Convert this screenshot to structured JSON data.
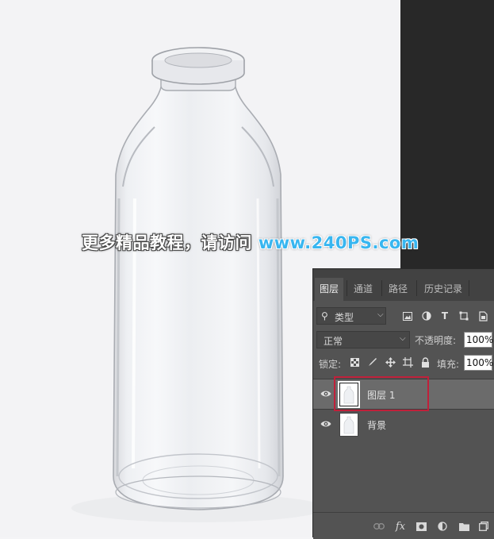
{
  "watermark": {
    "cn_text": "更多精品教程，请访问",
    "url_text": "www.240PS.com"
  },
  "layers_panel": {
    "tabs": [
      {
        "label": "图层",
        "active": true
      },
      {
        "label": "通道",
        "active": false
      },
      {
        "label": "路径",
        "active": false
      },
      {
        "label": "历史记录",
        "active": false
      }
    ],
    "filter": {
      "label": "类型",
      "icon": "search-icon"
    },
    "filter_icons": [
      "image-filter-icon",
      "adjustment-filter-icon",
      "type-filter-icon",
      "shape-filter-icon",
      "smart-object-filter-icon"
    ],
    "blend_mode": "正常",
    "opacity_label": "不透明度:",
    "opacity_value": "100%",
    "lock_label": "锁定:",
    "lock_icons": [
      "lock-transparent-icon",
      "lock-image-icon",
      "lock-position-icon",
      "lock-artboard-icon",
      "lock-all-icon"
    ],
    "fill_label": "填充:",
    "fill_value": "100%",
    "layers": [
      {
        "name": "图层 1",
        "selected": true,
        "visible": true
      },
      {
        "name": "背景",
        "selected": false,
        "visible": true
      }
    ],
    "bottom_icons": [
      "link-icon",
      "fx-icon",
      "mask-icon",
      "adjustment-icon",
      "folder-icon",
      "new-layer-icon"
    ],
    "highlight_color": "#c0203a"
  }
}
